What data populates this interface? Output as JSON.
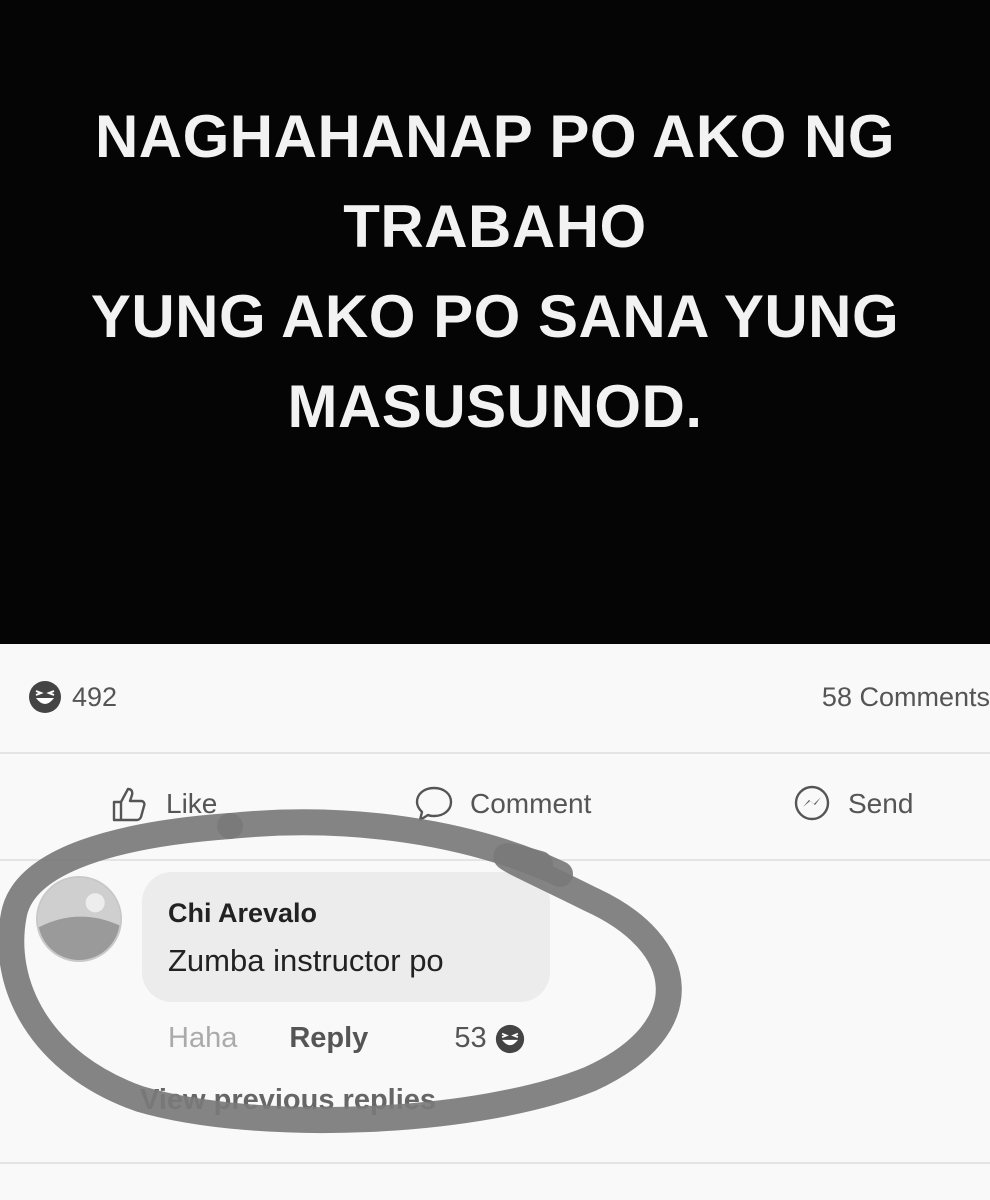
{
  "post": {
    "caption_lines": [
      "NAGHAHANAP PO AKO NG",
      "TRABAHO",
      "YUNG AKO PO SANA YUNG",
      "MASUSUNOD."
    ]
  },
  "stats": {
    "reaction_icon": "haha-emoji-icon",
    "reaction_count": "492",
    "comments_count": "58 Comments"
  },
  "actions": {
    "like_label": "Like",
    "comment_label": "Comment",
    "send_label": "Send"
  },
  "comment": {
    "author": "Chi Arevalo",
    "text": "Zumba instructor po",
    "haha_label": "Haha",
    "reply_label": "Reply",
    "reaction_count": "53",
    "reaction_icon": "haha-emoji-icon",
    "view_replies": "View previous replies"
  },
  "colors": {
    "post_background": "#050505",
    "caption": "#f2f2f2",
    "annotation_circle": "#7a7a7a"
  }
}
